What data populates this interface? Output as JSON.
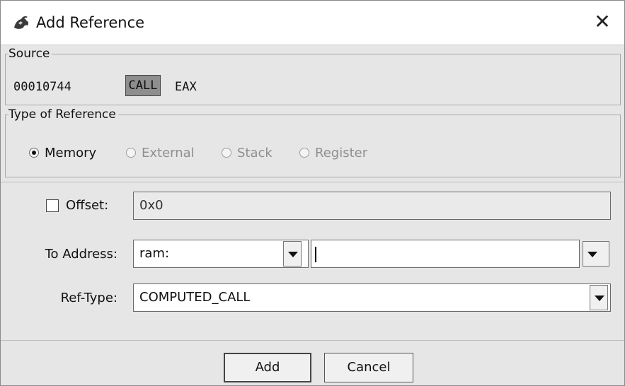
{
  "window": {
    "title": "Add Reference",
    "icon": "ghidra-dragon-icon",
    "close_label": "✕"
  },
  "source": {
    "legend": "Source",
    "address": "00010744",
    "mnemonic": "CALL",
    "operand": "EAX"
  },
  "reference_type": {
    "legend": "Type of Reference",
    "options": [
      {
        "label": "Memory",
        "selected": true,
        "enabled": true
      },
      {
        "label": "External",
        "selected": false,
        "enabled": false
      },
      {
        "label": "Stack",
        "selected": false,
        "enabled": false
      },
      {
        "label": "Register",
        "selected": false,
        "enabled": false
      }
    ]
  },
  "form": {
    "offset_label": "Offset:",
    "offset_checked": false,
    "offset_value": "0x0",
    "to_address_label": "To Address:",
    "address_space": "ram:",
    "address_value": "",
    "ref_type_label": "Ref-Type:",
    "ref_type_value": "COMPUTED_CALL"
  },
  "buttons": {
    "add": "Add",
    "cancel": "Cancel"
  },
  "colors": {
    "window_bg": "#e6e6e6",
    "mnemonic_highlight": "#8e8e8e"
  }
}
